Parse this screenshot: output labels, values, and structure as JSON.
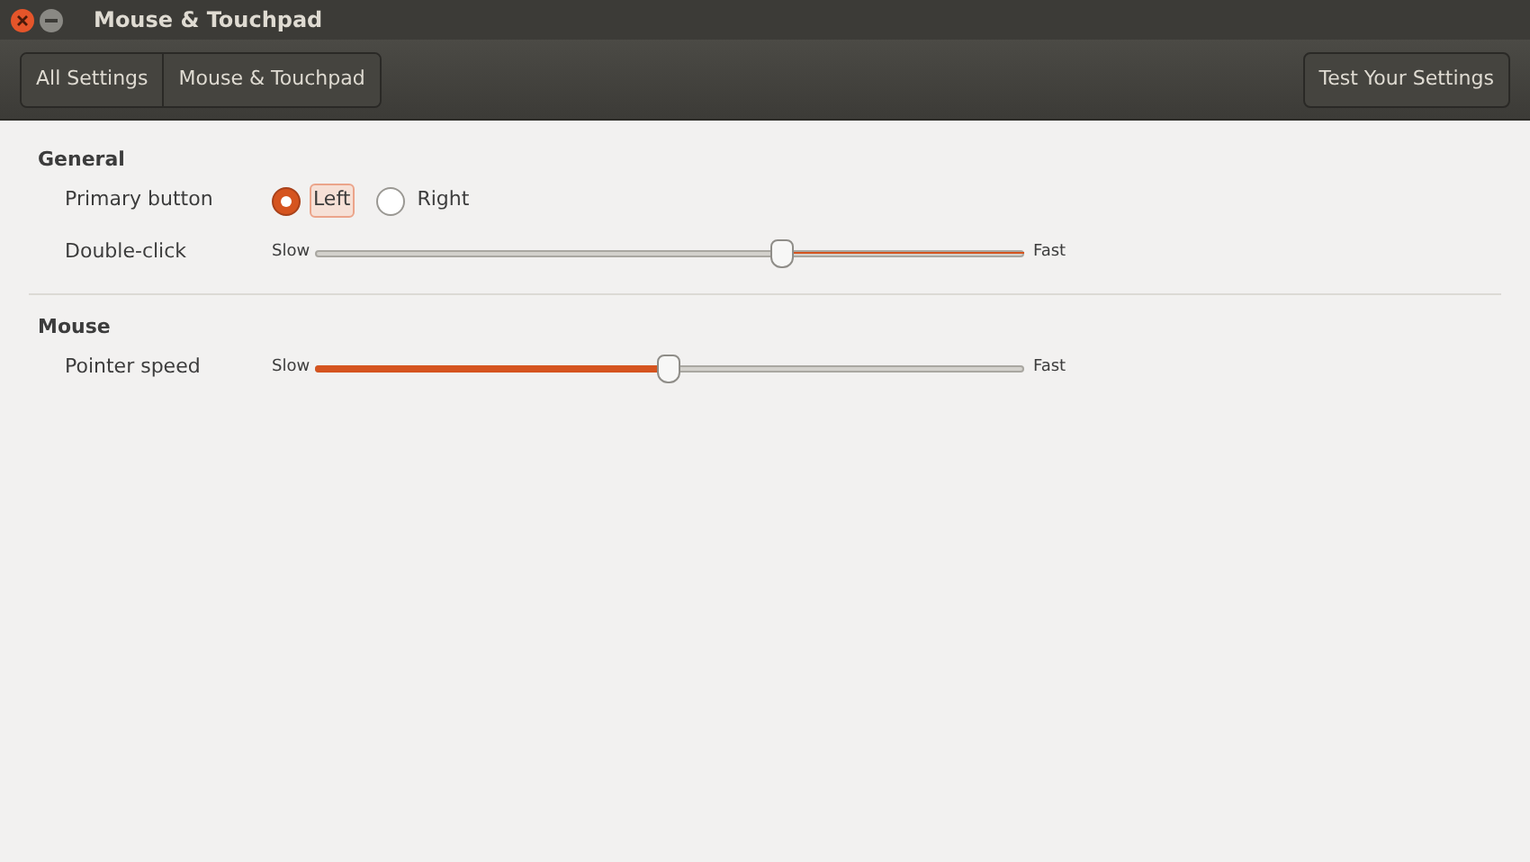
{
  "window": {
    "title": "Mouse & Touchpad"
  },
  "breadcrumbs": [
    {
      "label": "All Settings"
    },
    {
      "label": "Mouse & Touchpad"
    }
  ],
  "test_button": "Test Your Settings",
  "sections": [
    {
      "title": "General",
      "rows": [
        {
          "kind": "radio",
          "label": "Primary button",
          "options": [
            {
              "label": "Left",
              "selected": true
            },
            {
              "label": "Right",
              "selected": false
            }
          ]
        },
        {
          "kind": "slider",
          "label": "Double-click",
          "min_label": "Slow",
          "max_label": "Fast",
          "level": 0.66,
          "inverted": true
        }
      ]
    },
    {
      "title": "Mouse",
      "rows": [
        {
          "kind": "slider",
          "label": "Pointer speed",
          "min_label": "Slow",
          "max_label": "Fast",
          "level": 0.5,
          "inverted": false
        }
      ]
    }
  ]
}
